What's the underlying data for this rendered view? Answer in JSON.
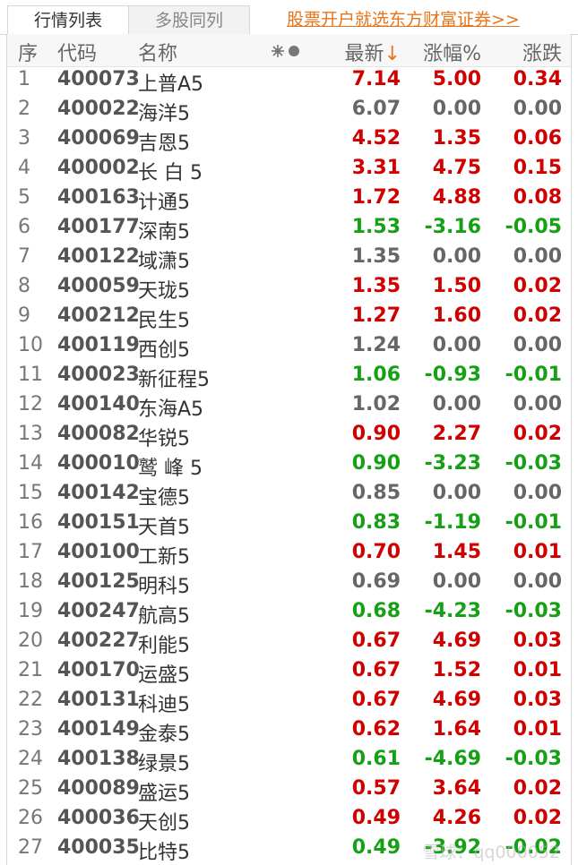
{
  "tabs": {
    "market_list": "行情列表",
    "multi_stock": "多股同列"
  },
  "promo_link": "股票开户就选东方财富证券>>",
  "header": {
    "seq": "序",
    "code": "代码",
    "name": "名称",
    "price": "最新",
    "price_sort_arrow": "↓",
    "pct": "涨幅%",
    "change": "涨跌"
  },
  "colors": {
    "up": "#d00000",
    "down": "#15a015",
    "flat": "#666666",
    "accent": "#e8741a"
  },
  "rows": [
    {
      "seq": "1",
      "code": "400073",
      "name": "上普A5",
      "price": "7.14",
      "pct": "5.00",
      "change": "0.34",
      "trend": "up"
    },
    {
      "seq": "2",
      "code": "400022",
      "name": "海洋5",
      "price": "6.07",
      "pct": "0.00",
      "change": "0.00",
      "trend": "flat"
    },
    {
      "seq": "3",
      "code": "400069",
      "name": "吉恩5",
      "price": "4.52",
      "pct": "1.35",
      "change": "0.06",
      "trend": "up"
    },
    {
      "seq": "4",
      "code": "400002",
      "name": "长 白 5",
      "price": "3.31",
      "pct": "4.75",
      "change": "0.15",
      "trend": "up"
    },
    {
      "seq": "5",
      "code": "400163",
      "name": "计通5",
      "price": "1.72",
      "pct": "4.88",
      "change": "0.08",
      "trend": "up"
    },
    {
      "seq": "6",
      "code": "400177",
      "name": "深南5",
      "price": "1.53",
      "pct": "-3.16",
      "change": "-0.05",
      "trend": "down"
    },
    {
      "seq": "7",
      "code": "400122",
      "name": "域潇5",
      "price": "1.35",
      "pct": "0.00",
      "change": "0.00",
      "trend": "flat"
    },
    {
      "seq": "8",
      "code": "400059",
      "name": "天珑5",
      "price": "1.35",
      "pct": "1.50",
      "change": "0.02",
      "trend": "up"
    },
    {
      "seq": "9",
      "code": "400212",
      "name": "民生5",
      "price": "1.27",
      "pct": "1.60",
      "change": "0.02",
      "trend": "up"
    },
    {
      "seq": "10",
      "code": "400119",
      "name": "西创5",
      "price": "1.24",
      "pct": "0.00",
      "change": "0.00",
      "trend": "flat"
    },
    {
      "seq": "11",
      "code": "400023",
      "name": "新征程5",
      "price": "1.06",
      "pct": "-0.93",
      "change": "-0.01",
      "trend": "down"
    },
    {
      "seq": "12",
      "code": "400140",
      "name": "东海A5",
      "price": "1.02",
      "pct": "0.00",
      "change": "0.00",
      "trend": "flat"
    },
    {
      "seq": "13",
      "code": "400082",
      "name": "华锐5",
      "price": "0.90",
      "pct": "2.27",
      "change": "0.02",
      "trend": "up"
    },
    {
      "seq": "14",
      "code": "400010",
      "name": "鹫 峰 5",
      "price": "0.90",
      "pct": "-3.23",
      "change": "-0.03",
      "trend": "down"
    },
    {
      "seq": "15",
      "code": "400142",
      "name": "宝德5",
      "price": "0.85",
      "pct": "0.00",
      "change": "0.00",
      "trend": "flat"
    },
    {
      "seq": "16",
      "code": "400151",
      "name": "天首5",
      "price": "0.83",
      "pct": "-1.19",
      "change": "-0.01",
      "trend": "down"
    },
    {
      "seq": "17",
      "code": "400100",
      "name": "工新5",
      "price": "0.70",
      "pct": "1.45",
      "change": "0.01",
      "trend": "up"
    },
    {
      "seq": "18",
      "code": "400125",
      "name": "明科5",
      "price": "0.69",
      "pct": "0.00",
      "change": "0.00",
      "trend": "flat"
    },
    {
      "seq": "19",
      "code": "400247",
      "name": "航高5",
      "price": "0.68",
      "pct": "-4.23",
      "change": "-0.03",
      "trend": "down"
    },
    {
      "seq": "20",
      "code": "400227",
      "name": "利能5",
      "price": "0.67",
      "pct": "4.69",
      "change": "0.03",
      "trend": "up"
    },
    {
      "seq": "21",
      "code": "400170",
      "name": "运盛5",
      "price": "0.67",
      "pct": "1.52",
      "change": "0.01",
      "trend": "up"
    },
    {
      "seq": "22",
      "code": "400131",
      "name": "科迪5",
      "price": "0.67",
      "pct": "4.69",
      "change": "0.03",
      "trend": "up"
    },
    {
      "seq": "23",
      "code": "400149",
      "name": "金泰5",
      "price": "0.62",
      "pct": "1.64",
      "change": "0.01",
      "trend": "up"
    },
    {
      "seq": "24",
      "code": "400138",
      "name": "绿景5",
      "price": "0.61",
      "pct": "-4.69",
      "change": "-0.03",
      "trend": "down"
    },
    {
      "seq": "25",
      "code": "400089",
      "name": "盛运5",
      "price": "0.57",
      "pct": "3.64",
      "change": "0.02",
      "trend": "up"
    },
    {
      "seq": "26",
      "code": "400036",
      "name": "天创5",
      "price": "0.49",
      "pct": "4.26",
      "change": "0.02",
      "trend": "up"
    },
    {
      "seq": "27",
      "code": "400035",
      "name": "比特5",
      "price": "0.49",
      "pct": "-3.92",
      "change": "-0.02",
      "trend": "down"
    }
  ],
  "watermark": "雪球：qq000052"
}
